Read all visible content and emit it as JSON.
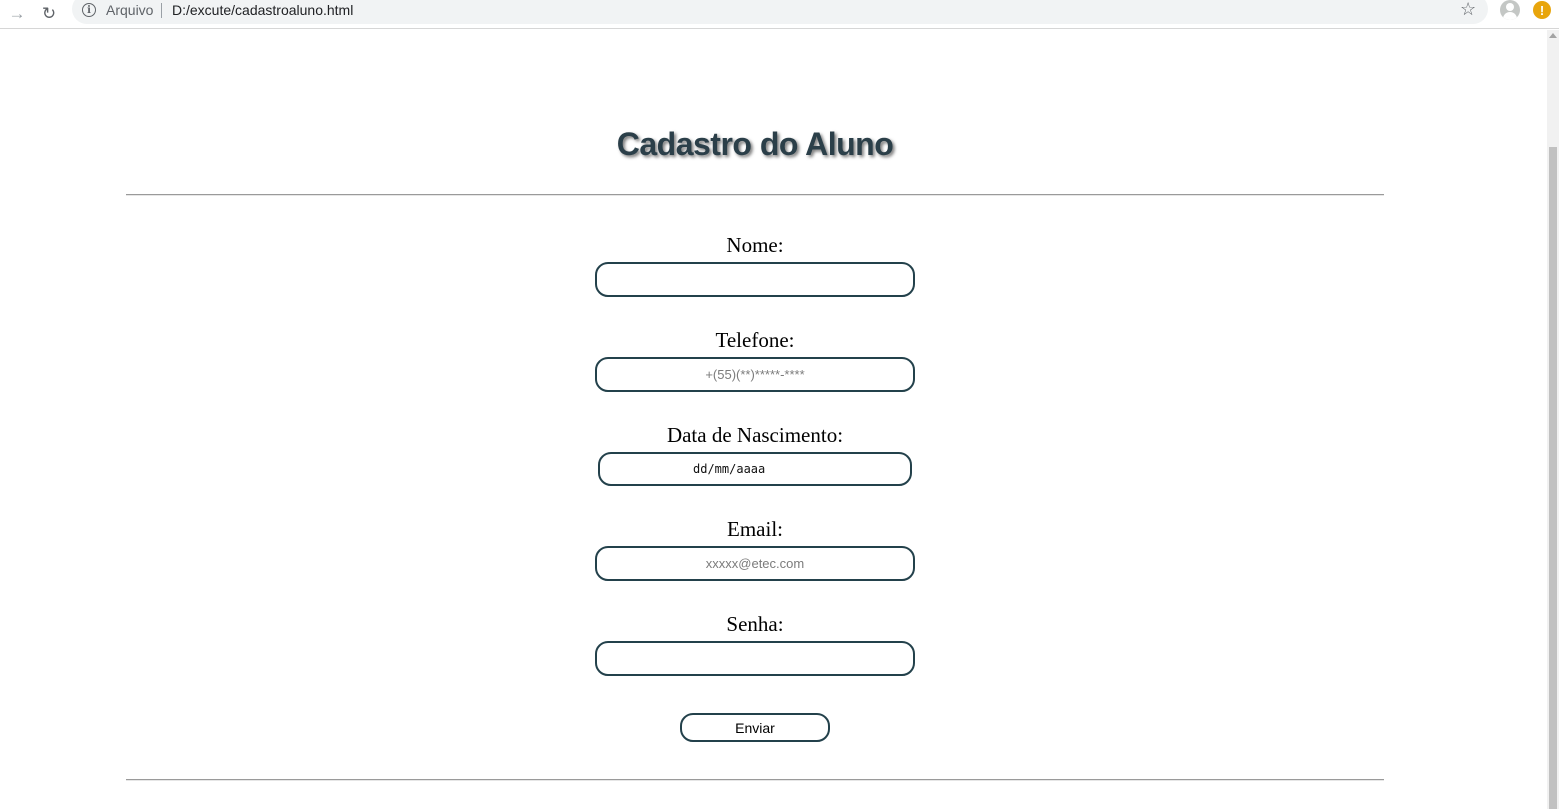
{
  "browser": {
    "site_label": "Arquivo",
    "url": "D:/excute/cadastroaluno.html",
    "icons": {
      "forward": "forward-arrow-icon",
      "reload": "reload-icon",
      "info": "info-icon",
      "star": "star-icon",
      "profile": "profile-icon",
      "alert": "alert-icon"
    },
    "alert_glyph": "!",
    "info_glyph": "i"
  },
  "page": {
    "title": "Cadastro do Aluno",
    "title_color": "#2b3f49",
    "border_color": "#23414b"
  },
  "form": {
    "nome": {
      "label": "Nome:",
      "value": "",
      "placeholder": ""
    },
    "telefone": {
      "label": "Telefone:",
      "value": "",
      "placeholder": "+(55)(**)*****-****"
    },
    "nascimento": {
      "label": "Data de Nascimento:",
      "value": "dd/mm/aaaa"
    },
    "email": {
      "label": "Email:",
      "value": "",
      "placeholder": "xxxxx@etec.com"
    },
    "senha": {
      "label": "Senha:",
      "value": "",
      "placeholder": ""
    },
    "submit_label": "Enviar"
  }
}
